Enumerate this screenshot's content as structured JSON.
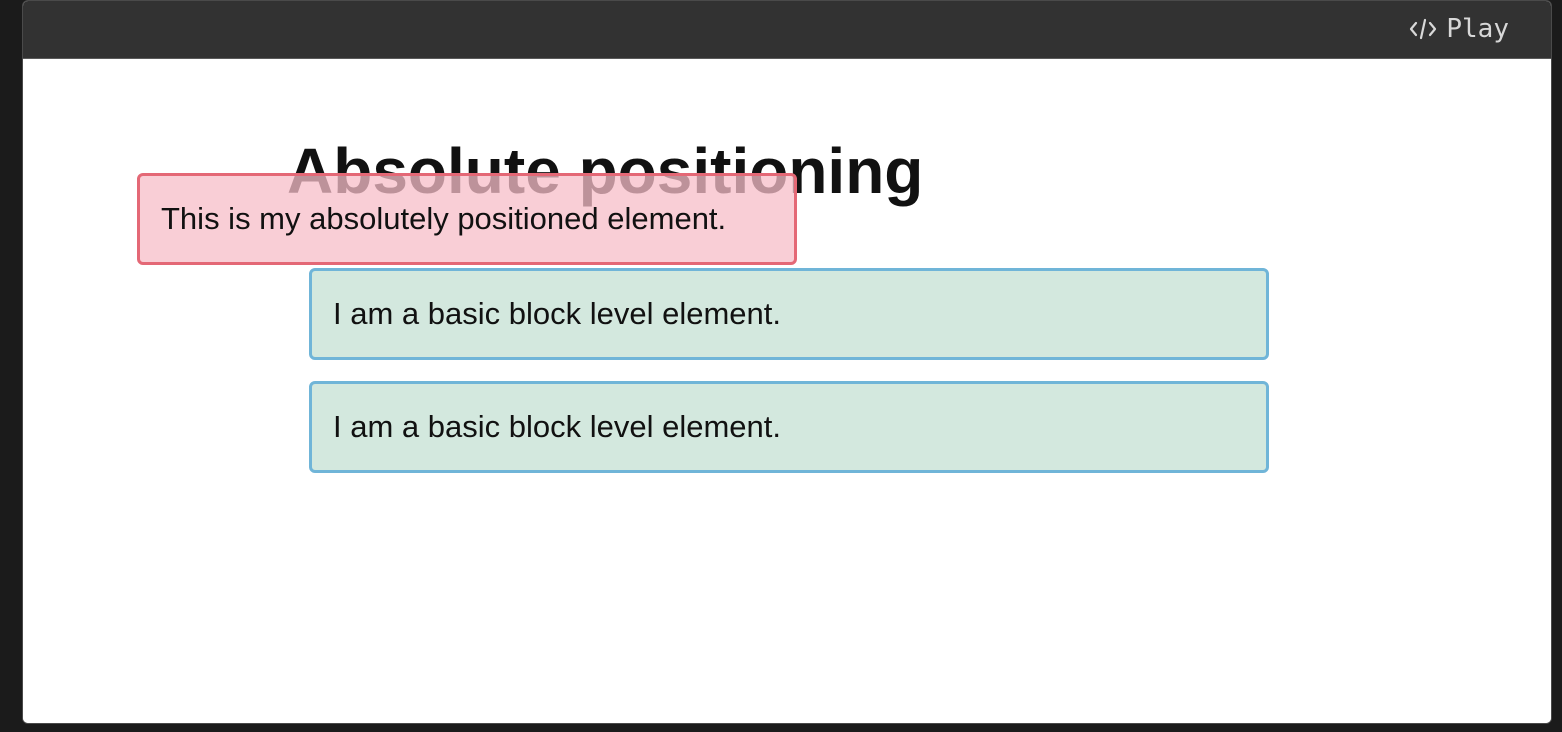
{
  "toolbar": {
    "play_label": "Play",
    "play_icon": "code-icon"
  },
  "example": {
    "heading": "Absolute positioning",
    "absolute_element_text": "This is my absolutely positioned element.",
    "blocks": [
      {
        "text": "I am a basic block level element."
      },
      {
        "text": "I am a basic block level element."
      }
    ]
  },
  "colors": {
    "toolbar_bg": "#323232",
    "absolute_bg": "#f7bec8",
    "absolute_border": "#e46876",
    "block_bg": "#d3e8de",
    "block_border": "#70b5d8"
  }
}
